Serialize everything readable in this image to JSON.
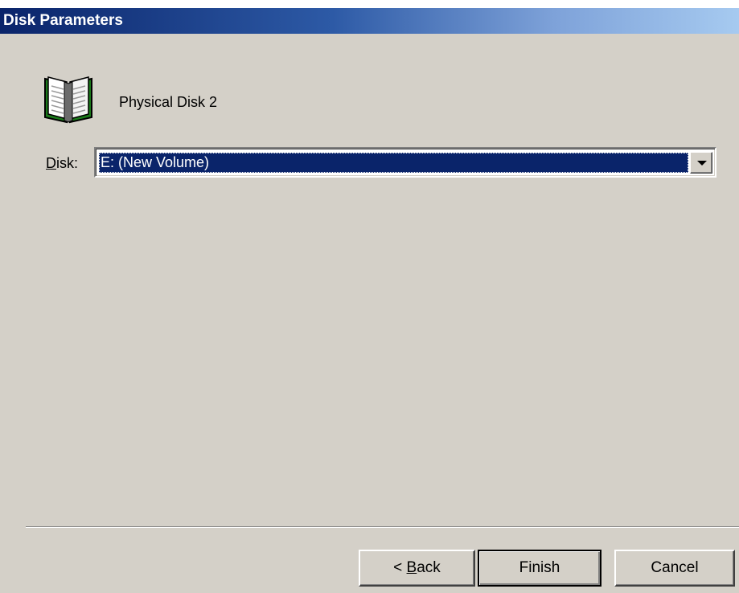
{
  "window": {
    "title": "Disk Parameters"
  },
  "header": {
    "disk_name": "Physical Disk 2",
    "icon": "book-icon"
  },
  "disk_field": {
    "label_first": "D",
    "label_rest": "isk:",
    "selected_value": "E: (New Volume)"
  },
  "buttons": {
    "back_prefix": "< ",
    "back_accel": "B",
    "back_rest": "ack",
    "finish": "Finish",
    "cancel": "Cancel"
  }
}
